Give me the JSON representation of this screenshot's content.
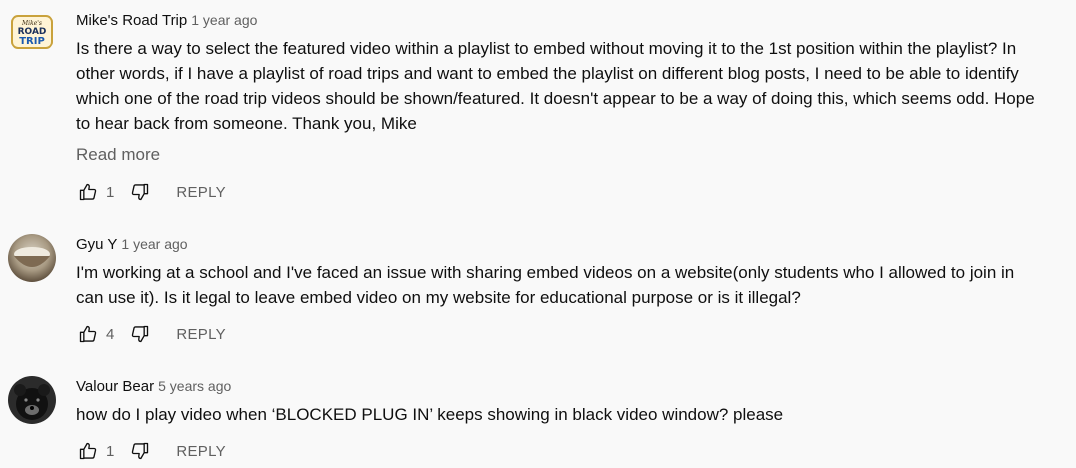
{
  "comments": [
    {
      "author": "Mike's Road Trip",
      "timestamp": "1 year ago",
      "text": "Is there a way to select the featured video within a playlist to embed without moving it to the 1st position within the playlist? In other words, if I have a playlist of road trips and want to embed the playlist on different blog posts, I need to be able to identify which one of the road trip videos should be shown/featured. It doesn't appear to be a way of doing this, which seems odd. Hope to hear back from someone. Thank you, Mike",
      "read_more": "Read more",
      "likes": "1",
      "reply_label": "REPLY",
      "avatar_text_top": "Mike's",
      "avatar_text_mid": "ROAD",
      "avatar_text_bot": "TRIP"
    },
    {
      "author": "Gyu Y",
      "timestamp": "1 year ago",
      "text": "I'm working at a school and I've faced an issue with sharing embed videos on a website(only students who I allowed to join in can use it). Is it legal to leave embed video on my website for educational purpose or is it illegal?",
      "likes": "4",
      "reply_label": "REPLY"
    },
    {
      "author": "Valour Bear",
      "timestamp": "5 years ago",
      "text": "how do I play video when ‘BLOCKED PLUG IN’ keeps showing in black video window? please",
      "likes": "1",
      "reply_label": "REPLY"
    }
  ],
  "icons": {
    "like": "thumbs-up-icon",
    "dislike": "thumbs-down-icon"
  },
  "colors": {
    "background": "#f9f9f9",
    "primary_text": "#0f0f0f",
    "secondary_text": "#606060"
  }
}
